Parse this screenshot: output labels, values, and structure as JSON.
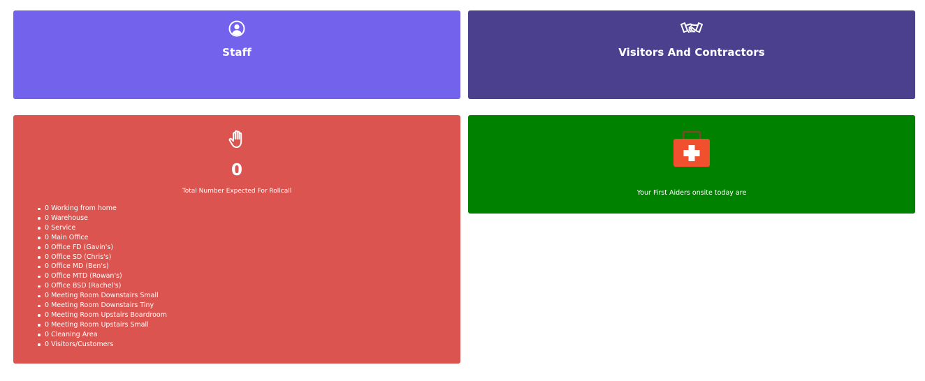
{
  "staff_card": {
    "title": "Staff",
    "icon": "user-circle-icon",
    "color": "#7363ec"
  },
  "visitors_card": {
    "title": "Visitors And Contractors",
    "icon": "handshake-icon",
    "color": "#4b408e"
  },
  "rollcall_card": {
    "icon": "hand-icon",
    "count": "0",
    "caption": "Total Number Expected For Rollcall",
    "color": "#db544f",
    "locations": [
      "0 Working from home",
      "0 Warehouse",
      "0 Service",
      "0 Main Office",
      "0 Office FD (Gavin's)",
      "0 Office SD (Chris's)",
      "0 Office MD (Ben's)",
      "0 Office MTD (Rowan's)",
      "0 Office BSD (Rachel's)",
      "0 Meeting Room Downstairs Small",
      "0 Meeting Room Downstairs Tiny",
      "0 Meeting Room Upstairs Boardroom",
      "0 Meeting Room Upstairs Small",
      "0 Cleaning Area",
      "0 Visitors/Customers"
    ]
  },
  "firstaid_card": {
    "icon": "first-aid-kit-icon",
    "text": "Your First Aiders onsite today are",
    "color": "#008100",
    "kit_color": "#f1502f"
  }
}
